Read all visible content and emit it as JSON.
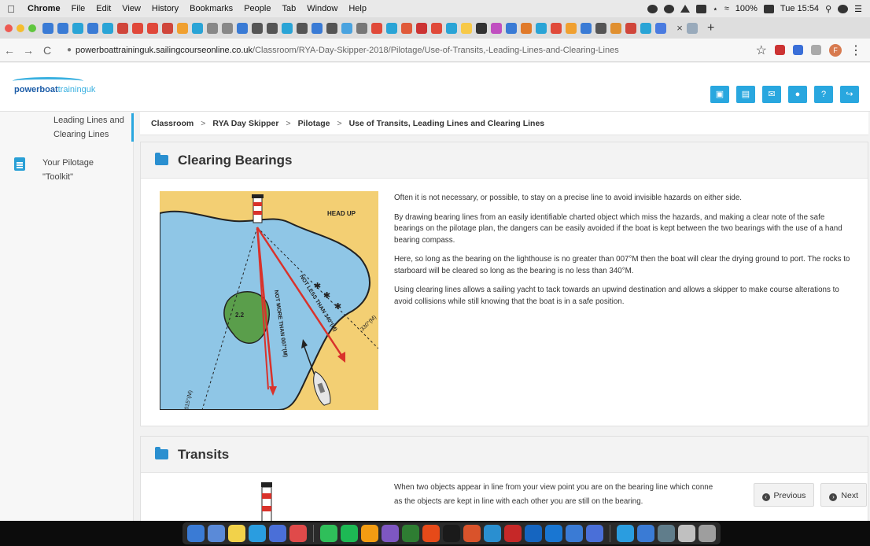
{
  "menubar": {
    "app_name": "Chrome",
    "menus": [
      "File",
      "Edit",
      "View",
      "History",
      "Bookmarks",
      "People",
      "Tab",
      "Window",
      "Help"
    ],
    "battery": "100%",
    "clock": "Tue 15:54"
  },
  "browser": {
    "tab_close": "×",
    "new_tab": "+",
    "url_host": "powerboattraininguk.sailingcourseonline.co.uk",
    "url_path": "/Classroom/RYA-Day-Skipper-2018/Pilotage/Use-of-Transits,-Leading-Lines-and-Clearing-Lines",
    "profile_initial": "F",
    "back": "←",
    "forward": "→",
    "reload": "C",
    "star": "☆"
  },
  "header": {
    "logo_bold": "powerboat",
    "logo_light": "traininguk",
    "icons": [
      "cart-icon",
      "book-icon",
      "mail-icon",
      "user-icon",
      "help-icon",
      "logout-icon"
    ]
  },
  "sidebar": {
    "items": [
      {
        "label_line1": "Leading Lines and",
        "label_line2": "Clearing Lines"
      },
      {
        "label_line1": "Your Pilotage",
        "label_line2": "\"Toolkit\""
      }
    ]
  },
  "breadcrumb": [
    "Classroom",
    "RYA Day Skipper",
    "Pilotage",
    "Use of Transits, Leading Lines and Clearing Lines"
  ],
  "breadcrumb_sep": ">",
  "sections": [
    {
      "title": "Clearing Bearings",
      "paragraphs": [
        "Often it is not necessary, or possible, to stay on a precise line to avoid invisible hazards on either side.",
        "By drawing bearing lines from an easily identifiable charted object which miss the hazards, and making a clear note of the safe bearings on the pilotage plan, the dangers can be easily avoided if the boat is kept between the two bearings with the use of a hand bearing compass.",
        "Here, so long as the bearing on the lighthouse is no greater than 007°M then the boat will clear the drying ground to port. The rocks to starboard will be cleared so long as the bearing is no less than 340°M.",
        "Using clearing lines allows a sailing yacht to tack towards an upwind destination and allows a skipper to make course alterations to avoid collisions while still knowing that the boat is in a safe position."
      ],
      "diagram": {
        "head_up": "HEAD UP",
        "depth": "2.2",
        "not_more": "NOT MORE THAN 007°(M)",
        "not_less": "NOT LESS THAN 340°(M)",
        "bearing_left": "015°(M)",
        "bearing_right": "330°(M)"
      }
    },
    {
      "title": "Transits",
      "paragraphs_line1": "When two objects appear in line from your view point you are on the bearing line which conne",
      "paragraphs_line2": "as the objects are kept in line with each other you are still on the bearing."
    }
  ],
  "pager": {
    "previous": "Previous",
    "next": "Next"
  },
  "colors": {
    "accent": "#29a7df",
    "sea": "#8fc6e6",
    "land": "#f3cf73",
    "island": "#5a9e4b",
    "bearing_red": "#d9322b"
  }
}
